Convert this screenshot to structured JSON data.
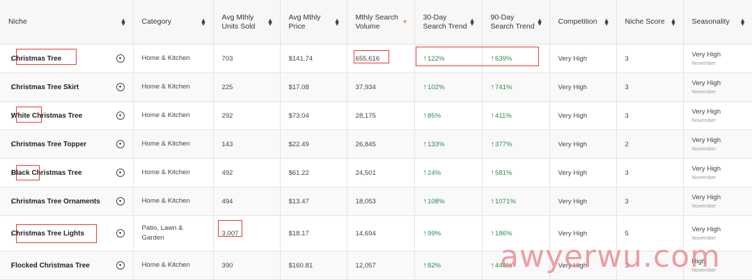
{
  "headers": {
    "niche": "Niche",
    "category": "Category",
    "units": "Avg Mthly Units Sold",
    "price": "Avg Mthly Price",
    "volume": "Mthly Search Volume",
    "trend30": "30-Day Search Trend",
    "trend90": "90-Day Search Trend",
    "competition": "Competition",
    "score": "Niche Score",
    "seasonality": "Seasonality"
  },
  "rows": [
    {
      "niche": "Christmas Tree",
      "category": "Home & Kitchen",
      "units": "703",
      "price": "$141.74",
      "volume": "655,616",
      "t30": "122%",
      "t90": "639%",
      "competition": "Very High",
      "score": "3",
      "season": "Very High",
      "season_month": "November"
    },
    {
      "niche": "Christmas Tree Skirt",
      "category": "Home & Kitchen",
      "units": "225",
      "price": "$17.08",
      "volume": "37,934",
      "t30": "102%",
      "t90": "741%",
      "competition": "Very High",
      "score": "3",
      "season": "Very High",
      "season_month": "November"
    },
    {
      "niche": "White Christmas Tree",
      "category": "Home & Kitchen",
      "units": "292",
      "price": "$73.04",
      "volume": "28,175",
      "t30": "85%",
      "t90": "411%",
      "competition": "Very High",
      "score": "3",
      "season": "Very High",
      "season_month": "November"
    },
    {
      "niche": "Christmas Tree Topper",
      "category": "Home & Kitchen",
      "units": "143",
      "price": "$22.49",
      "volume": "26,845",
      "t30": "133%",
      "t90": "377%",
      "competition": "Very High",
      "score": "2",
      "season": "Very High",
      "season_month": "November"
    },
    {
      "niche": "Black Christmas Tree",
      "category": "Home & Kitchen",
      "units": "492",
      "price": "$61.22",
      "volume": "24,501",
      "t30": "24%",
      "t90": "581%",
      "competition": "Very High",
      "score": "3",
      "season": "Very High",
      "season_month": "November"
    },
    {
      "niche": "Christmas Tree Ornaments",
      "category": "Home & Kitchen",
      "units": "494",
      "price": "$13.47",
      "volume": "18,053",
      "t30": "108%",
      "t90": "1071%",
      "competition": "Very High",
      "score": "3",
      "season": "Very High",
      "season_month": "November"
    },
    {
      "niche": "Christmas Tree Lights",
      "category": "Patio, Lawn & Garden",
      "units": "3,007",
      "price": "$18.17",
      "volume": "14,694",
      "t30": "99%",
      "t90": "186%",
      "competition": "Very High",
      "score": "5",
      "season": "Very High",
      "season_month": "November"
    },
    {
      "niche": "Flocked Christmas Tree",
      "category": "Home & Kitchen",
      "units": "390",
      "price": "$160.81",
      "volume": "12,057",
      "t30": "82%",
      "t90": "446%",
      "competition": "Very High",
      "score": "3",
      "season": "High",
      "season_month": "November"
    }
  ],
  "icons": {
    "row_expand": "chevron-right-icon",
    "niche_badge": "circle-badge-icon",
    "sort": "sort-icon",
    "sort_active": "sort-desc-icon",
    "trend": "arrow-up-icon"
  },
  "colors": {
    "trend_green": "#2c8a4f",
    "annotation_red": "#e53935",
    "sort_active": "#e8883a"
  },
  "watermark": "awyerwu.com"
}
